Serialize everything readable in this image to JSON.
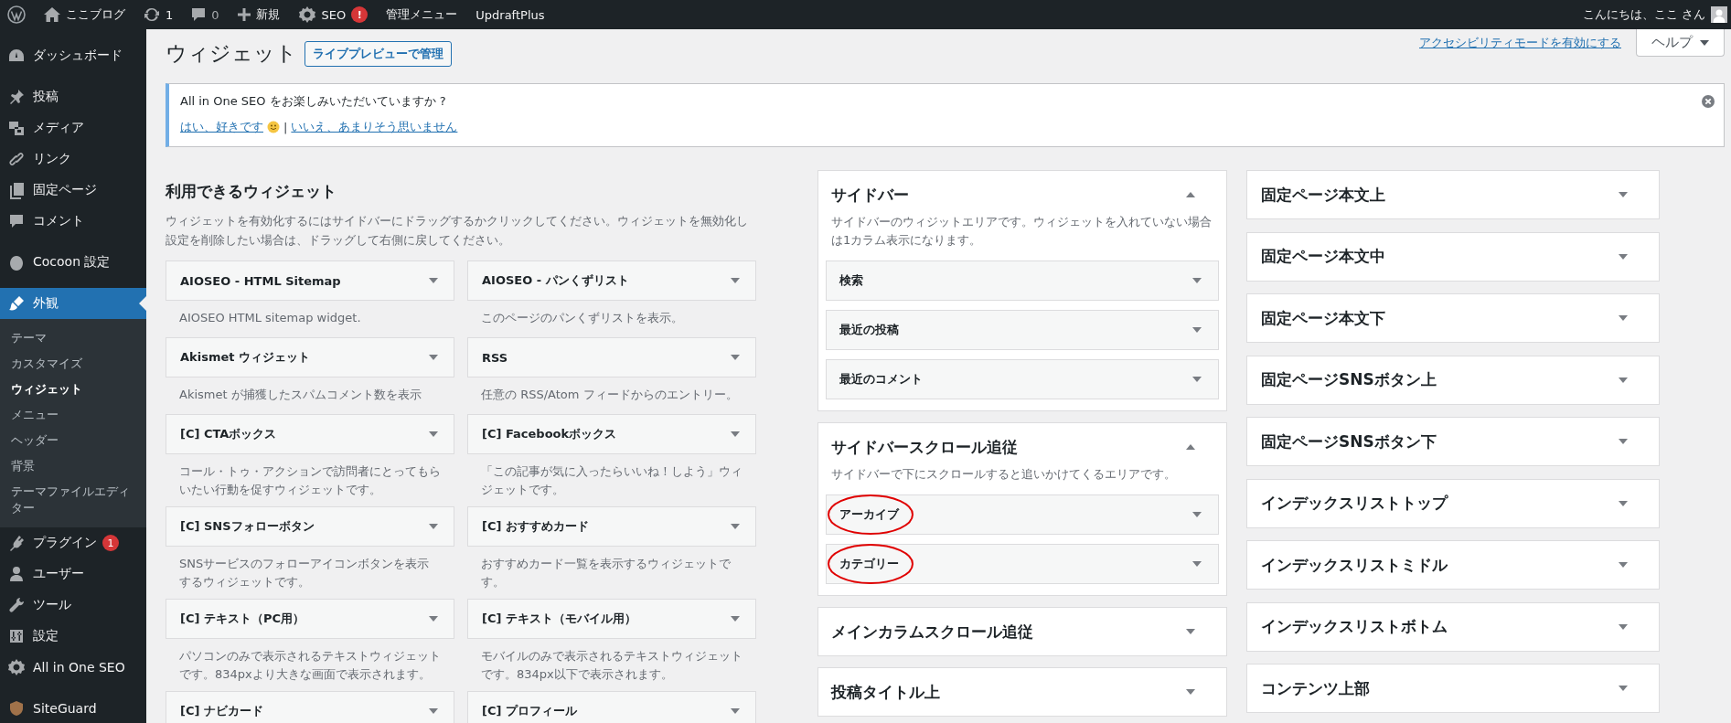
{
  "admin_bar": {
    "items": [
      {
        "kind": "site",
        "label": "ここブログ"
      },
      {
        "kind": "updates",
        "label": "1"
      },
      {
        "kind": "comments",
        "label": "0"
      },
      {
        "kind": "new",
        "label": "新規"
      },
      {
        "kind": "seo",
        "label": "SEO",
        "badge": "!"
      },
      {
        "kind": "text",
        "label": "管理メニュー"
      },
      {
        "kind": "text",
        "label": "UpdraftPlus"
      }
    ],
    "greeting": "こんにちは、ここ さん"
  },
  "sidebar": {
    "groups": [
      {
        "items": [
          {
            "kind": "dashboard",
            "label": "ダッシュボード",
            "selected": false
          }
        ]
      },
      {
        "items": [
          {
            "kind": "posts",
            "label": "投稿",
            "selected": false
          },
          {
            "kind": "media",
            "label": "メディア",
            "selected": false
          },
          {
            "kind": "links",
            "label": "リンク",
            "selected": false
          },
          {
            "kind": "pages",
            "label": "固定ページ",
            "selected": false
          },
          {
            "kind": "comments",
            "label": "コメント",
            "selected": false
          }
        ]
      },
      {
        "items": [
          {
            "kind": "cocoon",
            "label": "Cocoon 設定",
            "selected": false
          }
        ]
      },
      {
        "items": [
          {
            "kind": "appearance",
            "label": "外観",
            "selected": true,
            "children": [
              {
                "label": "テーマ",
                "selected": false
              },
              {
                "label": "カスタマイズ",
                "selected": false
              },
              {
                "label": "ウィジェット",
                "selected": true
              },
              {
                "label": "メニュー",
                "selected": false
              },
              {
                "label": "ヘッダー",
                "selected": false
              },
              {
                "label": "背景",
                "selected": false
              },
              {
                "label": "テーマファイルエディター",
                "selected": false
              }
            ]
          },
          {
            "kind": "plugins",
            "label": "プラグイン",
            "selected": false,
            "badge": "1"
          },
          {
            "kind": "users",
            "label": "ユーザー",
            "selected": false
          },
          {
            "kind": "tools",
            "label": "ツール",
            "selected": false
          },
          {
            "kind": "settings",
            "label": "設定",
            "selected": false
          },
          {
            "kind": "seo",
            "label": "All in One SEO",
            "selected": false
          }
        ]
      },
      {
        "items": [
          {
            "kind": "siteguard",
            "label": "SiteGuard",
            "selected": false
          }
        ]
      }
    ]
  },
  "page": {
    "title": "ウィジェット",
    "title_button": "ライブプレビューで管理",
    "accessibility_link": "アクセシビリティモードを有効にする",
    "help_button": "ヘルプ"
  },
  "notice": {
    "message": "All in One SEO をお楽しみいただいていますか ?",
    "yes_link": "はい、好きです",
    "separator": "|",
    "no_link": "いいえ、あまりそう思いません"
  },
  "available_widgets": {
    "heading": "利用できるウィジェット",
    "description": "ウィジェットを有効化するにはサイドバーにドラッグするかクリックしてください。ウィジェットを無効化し設定を削除したい場合は、ドラッグして右側に戻してください。",
    "widgets": [
      {
        "title": "AIOSEO - HTML Sitemap",
        "description": "AIOSEO HTML sitemap widget."
      },
      {
        "title": "AIOSEO - パンくずリスト",
        "description": "このページのパンくずリストを表示。"
      },
      {
        "title": "Akismet ウィジェット",
        "description": "Akismet が捕獲したスパムコメント数を表示"
      },
      {
        "title": "RSS",
        "description": "任意の RSS/Atom フィードからのエントリー。"
      },
      {
        "title": "[C] CTAボックス",
        "description": "コール・トゥ・アクションで訪問者にとってもらいたい行動を促すウィジェットです。"
      },
      {
        "title": "[C] Facebookボックス",
        "description": "「この記事が気に入ったらいいね！しよう」ウィジェットです。"
      },
      {
        "title": "[C] SNSフォローボタン",
        "description": "SNSサービスのフォローアイコンボタンを表示するウィジェットです。"
      },
      {
        "title": "[C] おすすめカード",
        "description": "おすすめカード一覧を表示するウィジェットです。"
      },
      {
        "title": "[C] テキスト（PC用）",
        "description": "パソコンのみで表示されるテキストウィジェットです。834pxより大きな画面で表示されます。"
      },
      {
        "title": "[C] テキスト（モバイル用）",
        "description": "モバイルのみで表示されるテキストウィジェットです。834px以下で表示されます。"
      },
      {
        "title": "[C] ナビカード"
      },
      {
        "title": "[C] プロフィール"
      }
    ]
  },
  "sidebars_column_1": [
    {
      "title": "サイドバー",
      "description": "サイドバーのウィジットエリアです。ウィジェットを入れていない場合は1カラム表示になります。",
      "expanded": true,
      "widgets": [
        {
          "title": "検索",
          "highlighted": false
        },
        {
          "title": "最近の投稿",
          "highlighted": false
        },
        {
          "title": "最近のコメント",
          "highlighted": false
        }
      ]
    },
    {
      "title": "サイドバースクロール追従",
      "description": "サイドバーで下にスクロールすると追いかけてくるエリアです。",
      "expanded": true,
      "widgets": [
        {
          "title": "アーカイブ",
          "highlighted": true
        },
        {
          "title": "カテゴリー",
          "highlighted": true
        }
      ]
    },
    {
      "title": "メインカラムスクロール追従",
      "expanded": false
    },
    {
      "title": "投稿タイトル上",
      "expanded": false
    }
  ],
  "sidebars_column_2": [
    {
      "title": "固定ページ本文上",
      "expanded": false
    },
    {
      "title": "固定ページ本文中",
      "expanded": false
    },
    {
      "title": "固定ページ本文下",
      "expanded": false
    },
    {
      "title": "固定ページSNSボタン上",
      "expanded": false
    },
    {
      "title": "固定ページSNSボタン下",
      "expanded": false
    },
    {
      "title": "インデックスリストトップ",
      "expanded": false
    },
    {
      "title": "インデックスリストミドル",
      "expanded": false
    },
    {
      "title": "インデックスリストボトム",
      "expanded": false
    },
    {
      "title": "コンテンツ上部",
      "expanded": false
    }
  ]
}
